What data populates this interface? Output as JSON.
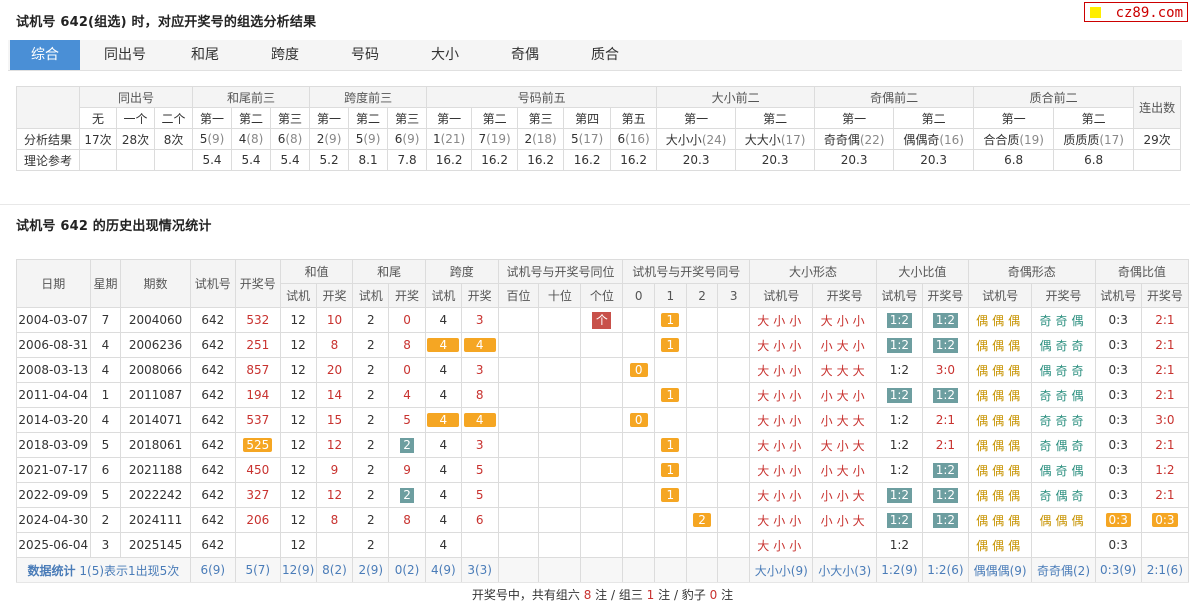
{
  "site_logo": "cz89.com",
  "title1": "试机号 642(组选) 时，对应开奖号的组选分析结果",
  "tabs": [
    "综合",
    "同出号",
    "和尾",
    "跨度",
    "号码",
    "大小",
    "奇偶",
    "质合"
  ],
  "summary": {
    "groups": [
      "同出号",
      "和尾前三",
      "跨度前三",
      "号码前五",
      "大小前二",
      "奇偶前二",
      "质合前二",
      "连出数"
    ],
    "sub": [
      "无",
      "一个",
      "二个",
      "第一",
      "第二",
      "第三",
      "第一",
      "第二",
      "第三",
      "第一",
      "第二",
      "第三",
      "第四",
      "第五",
      "第一",
      "第二",
      "第一",
      "第二",
      "第一",
      "第二"
    ],
    "row1_label": "分析结果",
    "row1": [
      [
        "17次",
        ""
      ],
      [
        "28次",
        ""
      ],
      [
        "8次",
        ""
      ],
      [
        "5",
        "(9)"
      ],
      [
        "4",
        "(8)"
      ],
      [
        "6",
        "(8)"
      ],
      [
        "2",
        "(9)"
      ],
      [
        "5",
        "(9)"
      ],
      [
        "6",
        "(9)"
      ],
      [
        "1",
        "(21)"
      ],
      [
        "7",
        "(19)"
      ],
      [
        "2",
        "(18)"
      ],
      [
        "5",
        "(17)"
      ],
      [
        "6",
        "(16)"
      ],
      [
        "大小小",
        "(24)"
      ],
      [
        "大大小",
        "(17)"
      ],
      [
        "奇奇偶",
        "(22)"
      ],
      [
        "偶偶奇",
        "(16)"
      ],
      [
        "合合质",
        "(19)"
      ],
      [
        "质质质",
        "(17)"
      ],
      [
        "29次",
        ""
      ]
    ],
    "row2_label": "理论参考",
    "row2": [
      "",
      "",
      "",
      "5.4",
      "5.4",
      "5.4",
      "5.2",
      "8.1",
      "7.8",
      "16.2",
      "16.2",
      "16.2",
      "16.2",
      "16.2",
      "20.3",
      "20.3",
      "20.3",
      "20.3",
      "6.8",
      "6.8",
      ""
    ]
  },
  "title2": "试机号 642 的历史出现情况统计",
  "history": {
    "h_date": "日期",
    "h_week": "星期",
    "h_issue": "期数",
    "h_test": "试机号",
    "h_draw": "开奖号",
    "g_sum": "和值",
    "g_tail": "和尾",
    "g_span": "跨度",
    "g_pos": "试机号与开奖号同位",
    "g_same": "试机号与开奖号同号",
    "g_size": "大小形态",
    "g_sizer": "大小比值",
    "g_odd": "奇偶形态",
    "g_oddr": "奇偶比值",
    "s_test": "试机",
    "s_draw": "开奖",
    "s_pos": [
      "百位",
      "十位",
      "个位"
    ],
    "s_same": [
      "0",
      "1",
      "2",
      "3"
    ],
    "s_test_no": "试机号",
    "s_draw_no": "开奖号",
    "rows": [
      {
        "date": "2004-03-07",
        "week": "7",
        "issue": "2004060",
        "test": "642",
        "draw": "532",
        "draw_hl": false,
        "sum_t": "12",
        "sum_d": "10",
        "tail_t": "2",
        "tail_d": "0",
        "tail_hl": false,
        "span_t": "4",
        "span_d": "3",
        "span_hl": false,
        "pos": [
          "",
          "",
          "个"
        ],
        "same_col": 1,
        "same_val": "1",
        "size_t": "大小小",
        "size_d": "大小小",
        "sr_t": "1:2",
        "sr_t_hl": true,
        "sr_d": "1:2",
        "sr_d_hl": true,
        "odd_t": "偶偶偶",
        "odd_d": "奇奇偶",
        "or_t": "0:3",
        "or_d": "2:1",
        "or_hl": false
      },
      {
        "date": "2006-08-31",
        "week": "4",
        "issue": "2006236",
        "test": "642",
        "draw": "251",
        "draw_hl": false,
        "sum_t": "12",
        "sum_d": "8",
        "tail_t": "2",
        "tail_d": "8",
        "tail_hl": false,
        "span_t": "4",
        "span_d": "4",
        "span_hl": true,
        "pos": [
          "",
          "",
          ""
        ],
        "same_col": 1,
        "same_val": "1",
        "size_t": "大小小",
        "size_d": "小大小",
        "sr_t": "1:2",
        "sr_t_hl": true,
        "sr_d": "1:2",
        "sr_d_hl": true,
        "odd_t": "偶偶偶",
        "odd_d": "偶奇奇",
        "or_t": "0:3",
        "or_d": "2:1",
        "or_hl": false
      },
      {
        "date": "2008-03-13",
        "week": "4",
        "issue": "2008066",
        "test": "642",
        "draw": "857",
        "draw_hl": false,
        "sum_t": "12",
        "sum_d": "20",
        "tail_t": "2",
        "tail_d": "0",
        "tail_hl": false,
        "span_t": "4",
        "span_d": "3",
        "span_hl": false,
        "pos": [
          "",
          "",
          ""
        ],
        "same_col": 0,
        "same_val": "0",
        "size_t": "大小小",
        "size_d": "大大大",
        "sr_t": "1:2",
        "sr_t_hl": false,
        "sr_d": "3:0",
        "sr_d_hl": false,
        "odd_t": "偶偶偶",
        "odd_d": "偶奇奇",
        "or_t": "0:3",
        "or_d": "2:1",
        "or_hl": false
      },
      {
        "date": "2011-04-04",
        "week": "1",
        "issue": "2011087",
        "test": "642",
        "draw": "194",
        "draw_hl": false,
        "sum_t": "12",
        "sum_d": "14",
        "tail_t": "2",
        "tail_d": "4",
        "tail_hl": false,
        "span_t": "4",
        "span_d": "8",
        "span_hl": false,
        "pos": [
          "",
          "",
          ""
        ],
        "same_col": 1,
        "same_val": "1",
        "size_t": "大小小",
        "size_d": "小大小",
        "sr_t": "1:2",
        "sr_t_hl": true,
        "sr_d": "1:2",
        "sr_d_hl": true,
        "odd_t": "偶偶偶",
        "odd_d": "奇奇偶",
        "or_t": "0:3",
        "or_d": "2:1",
        "or_hl": false
      },
      {
        "date": "2014-03-20",
        "week": "4",
        "issue": "2014071",
        "test": "642",
        "draw": "537",
        "draw_hl": false,
        "sum_t": "12",
        "sum_d": "15",
        "tail_t": "2",
        "tail_d": "5",
        "tail_hl": false,
        "span_t": "4",
        "span_d": "4",
        "span_hl": true,
        "pos": [
          "",
          "",
          ""
        ],
        "same_col": 0,
        "same_val": "0",
        "size_t": "大小小",
        "size_d": "小大大",
        "sr_t": "1:2",
        "sr_t_hl": false,
        "sr_d": "2:1",
        "sr_d_hl": false,
        "odd_t": "偶偶偶",
        "odd_d": "奇奇奇",
        "or_t": "0:3",
        "or_d": "3:0",
        "or_hl": false
      },
      {
        "date": "2018-03-09",
        "week": "5",
        "issue": "2018061",
        "test": "642",
        "draw": "525",
        "draw_hl": true,
        "sum_t": "12",
        "sum_d": "12",
        "tail_t": "2",
        "tail_d": "2",
        "tail_hl": true,
        "span_t": "4",
        "span_d": "3",
        "span_hl": false,
        "pos": [
          "",
          "",
          ""
        ],
        "same_col": 1,
        "same_val": "1",
        "size_t": "大小小",
        "size_d": "大小大",
        "sr_t": "1:2",
        "sr_t_hl": false,
        "sr_d": "2:1",
        "sr_d_hl": false,
        "odd_t": "偶偶偶",
        "odd_d": "奇偶奇",
        "or_t": "0:3",
        "or_d": "2:1",
        "or_hl": false
      },
      {
        "date": "2021-07-17",
        "week": "6",
        "issue": "2021188",
        "test": "642",
        "draw": "450",
        "draw_hl": false,
        "sum_t": "12",
        "sum_d": "9",
        "tail_t": "2",
        "tail_d": "9",
        "tail_hl": false,
        "span_t": "4",
        "span_d": "5",
        "span_hl": false,
        "pos": [
          "",
          "",
          ""
        ],
        "same_col": 1,
        "same_val": "1",
        "size_t": "大小小",
        "size_d": "小大小",
        "sr_t": "1:2",
        "sr_t_hl": false,
        "sr_d": "1:2",
        "sr_d_hl": true,
        "odd_t": "偶偶偶",
        "odd_d": "偶奇偶",
        "or_t": "0:3",
        "or_d": "1:2",
        "or_hl": false
      },
      {
        "date": "2022-09-09",
        "week": "5",
        "issue": "2022242",
        "test": "642",
        "draw": "327",
        "draw_hl": false,
        "sum_t": "12",
        "sum_d": "12",
        "tail_t": "2",
        "tail_d": "2",
        "tail_hl": true,
        "span_t": "4",
        "span_d": "5",
        "span_hl": false,
        "pos": [
          "",
          "",
          ""
        ],
        "same_col": 1,
        "same_val": "1",
        "size_t": "大小小",
        "size_d": "小小大",
        "sr_t": "1:2",
        "sr_t_hl": true,
        "sr_d": "1:2",
        "sr_d_hl": true,
        "odd_t": "偶偶偶",
        "odd_d": "奇偶奇",
        "or_t": "0:3",
        "or_d": "2:1",
        "or_hl": false
      },
      {
        "date": "2024-04-30",
        "week": "2",
        "issue": "2024111",
        "test": "642",
        "draw": "206",
        "draw_hl": false,
        "sum_t": "12",
        "sum_d": "8",
        "tail_t": "2",
        "tail_d": "8",
        "tail_hl": false,
        "span_t": "4",
        "span_d": "6",
        "span_hl": false,
        "pos": [
          "",
          "",
          ""
        ],
        "same_col": 2,
        "same_val": "2",
        "size_t": "大小小",
        "size_d": "小小大",
        "sr_t": "1:2",
        "sr_t_hl": true,
        "sr_d": "1:2",
        "sr_d_hl": true,
        "odd_t": "偶偶偶",
        "odd_d": "偶偶偶",
        "or_t": "0:3",
        "or_d": "0:3",
        "or_hl": true
      },
      {
        "date": "2025-06-04",
        "week": "3",
        "issue": "2025145",
        "test": "642",
        "draw": "",
        "draw_hl": false,
        "sum_t": "12",
        "sum_d": "",
        "tail_t": "2",
        "tail_d": "",
        "tail_hl": false,
        "span_t": "4",
        "span_d": "",
        "span_hl": false,
        "pos": [
          "",
          "",
          ""
        ],
        "same_col": -1,
        "same_val": "",
        "size_t": "大小小",
        "size_d": "",
        "sr_t": "1:2",
        "sr_t_hl": false,
        "sr_d": "",
        "sr_d_hl": false,
        "odd_t": "偶偶偶",
        "odd_d": "",
        "or_t": "0:3",
        "or_d": "",
        "or_hl": false
      }
    ],
    "stats": {
      "label": "数据统计",
      "note": "1(5)表示1出现5次",
      "test": "6(9)",
      "draw": "5(7)",
      "sum_t": "12(9)",
      "sum_d": "8(2)",
      "tail_t": "2(9)",
      "tail_d": "0(2)",
      "span_t": "4(9)",
      "span_d": "3(3)",
      "size_t": "大小小(9)",
      "size_d": "小大小(3)",
      "sr_t": "1:2(9)",
      "sr_d": "1:2(6)",
      "odd_t": "偶偶偶(9)",
      "odd_d": "奇奇偶(2)",
      "or_t": "0:3(9)",
      "or_d": "2:1(6)"
    }
  },
  "footer": {
    "pre": "开奖号中，共有组六 ",
    "n6": "8",
    "mid1": " 注 / 组三 ",
    "n3": "1",
    "mid2": " 注 / 豹子 ",
    "n0": "0",
    "post": " 注"
  },
  "colors": {
    "tab_active": "#4a8fd6",
    "orange": "#f5a623",
    "red": "#c8322f",
    "teal": "#6d9ea0",
    "link": "#4a7cb8"
  }
}
